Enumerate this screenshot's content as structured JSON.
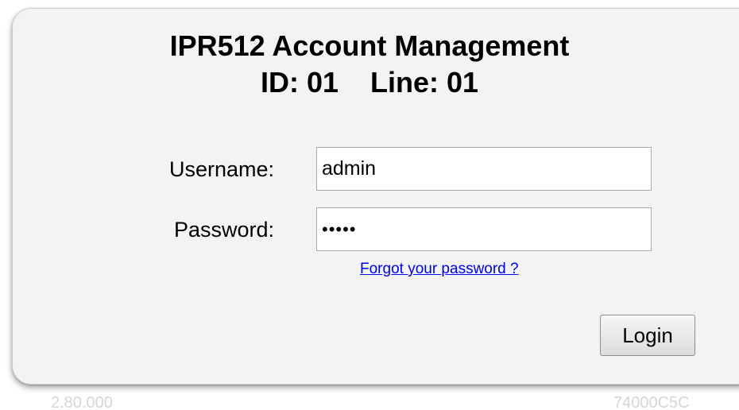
{
  "header": {
    "title": "IPR512 Account Management",
    "id_line": "ID: 01    Line: 01"
  },
  "form": {
    "username_label": "Username:",
    "username_value": "admin",
    "password_label": "Password:",
    "password_value": "•••••",
    "forgot_link": "Forgot your password ?",
    "login_button": "Login"
  },
  "footer": {
    "version": "2.80.000",
    "serial": "74000C5C"
  }
}
